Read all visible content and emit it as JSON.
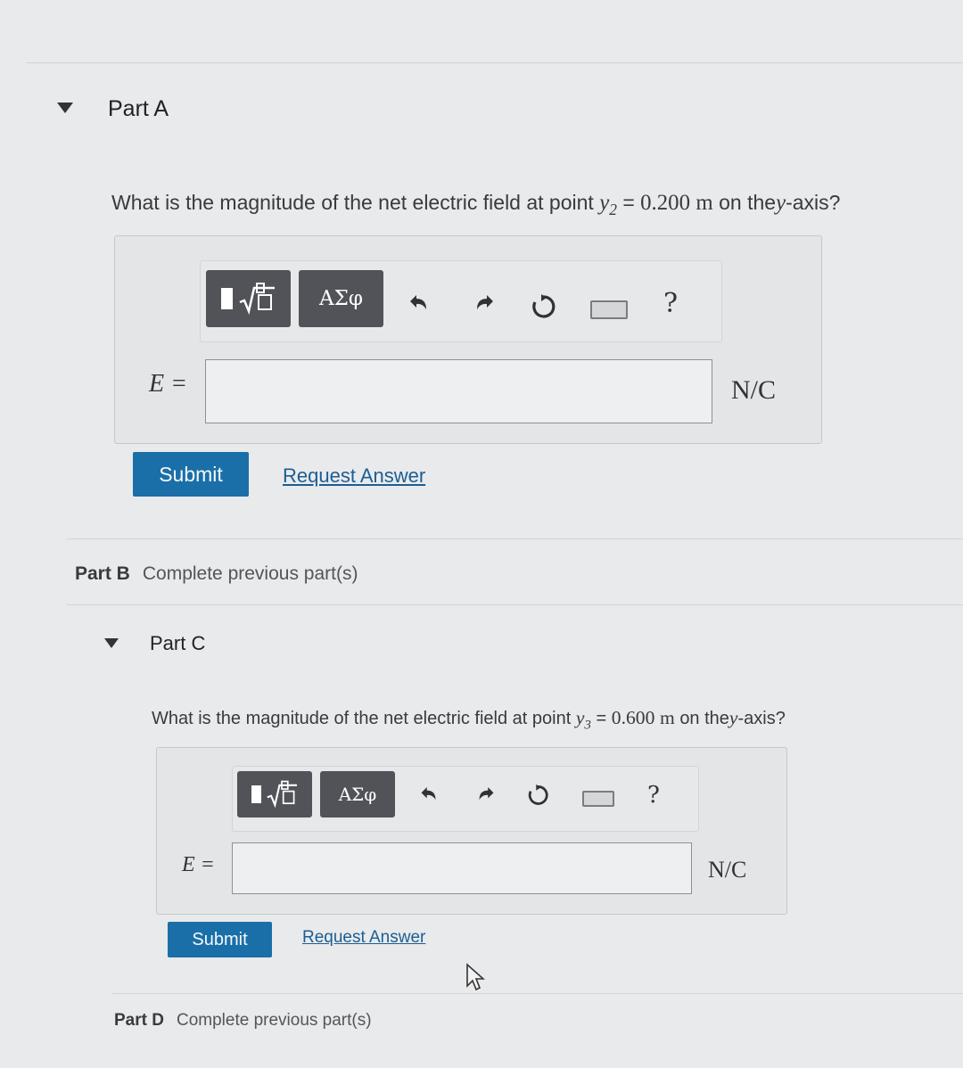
{
  "part_a": {
    "title": "Part A",
    "question_text": "What is the magnitude of the net electric field at point",
    "point_var": "y",
    "point_sub": "2",
    "equals": "=",
    "point_value": "0.200",
    "point_unit": "m",
    "question_tail": "on the",
    "axis_var": "y",
    "question_end": "-axis?",
    "toolbar": {
      "greek_label": "ΑΣφ",
      "help_label": "?"
    },
    "field_label": "E =",
    "input_value": "",
    "unit": "N/C",
    "submit_label": "Submit",
    "request_answer_label": "Request Answer"
  },
  "part_b": {
    "label": "Part B",
    "status": "Complete previous part(s)"
  },
  "part_c": {
    "title": "Part C",
    "question_text": "What is the magnitude of the net electric field at point",
    "point_var": "y",
    "point_sub": "3",
    "equals": "=",
    "point_value": "0.600",
    "point_unit": "m",
    "question_tail": "on the",
    "axis_var": "y",
    "question_end": "-axis?",
    "toolbar": {
      "greek_label": "ΑΣφ",
      "help_label": "?"
    },
    "field_label": "E =",
    "input_value": "",
    "unit": "N/C",
    "submit_label": "Submit",
    "request_answer_label": "Request Answer"
  },
  "part_d": {
    "label": "Part D",
    "status": "Complete previous part(s)"
  }
}
